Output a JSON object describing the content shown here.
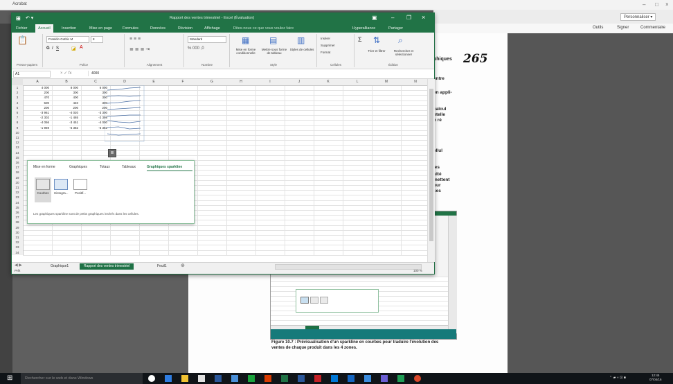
{
  "acrobat": {
    "menu": {
      "personalize": "Personnaliser ▾",
      "tools": "Outils",
      "sign": "Signer",
      "comment": "Commentaire"
    },
    "page_number": "265",
    "doc_heading_frag": "phiques",
    "doc_lines": [
      "entre",
      "en appli-",
      "calcul",
      "ntelle",
      "n ré",
      "ellul",
      "les",
      "ulté",
      "mettent",
      "our",
      "ces"
    ],
    "figure_caption": "Figure 10.7 : Prévisualisation d'un sparkline en courbes pour traduire l'évolution des ventes de chaque produit dans les 4 zones."
  },
  "excel": {
    "title": "Rapport des ventes trimestriel - Excel (Évaluation)",
    "account": "Hyperalliance",
    "share": "Partager",
    "tabs": [
      "Fichier",
      "Accueil",
      "Insertion",
      "Mise en page",
      "Formules",
      "Données",
      "Révision",
      "Affichage",
      "Dites-nous ce que vous voulez faire"
    ],
    "ribbon": {
      "font_name": "Franklin Gothic M",
      "font_size": "8",
      "number_format": "Standard",
      "groups": [
        "Presse-papiers",
        "Police",
        "Alignement",
        "Nombre",
        "Style",
        "Cellules",
        "Édition"
      ],
      "items": {
        "cond_format": "Mise en forme conditionnelle",
        "as_table": "Mettre sous forme de tableau",
        "cell_styles": "Styles de cellules",
        "insert": "Insérer",
        "delete": "Supprimer",
        "format": "Format",
        "sort_filter": "Trier et filtrer",
        "find_select": "Rechercher et sélectionner"
      }
    },
    "formula_bar": {
      "name_box": "A1",
      "formula": "4000"
    },
    "columns": [
      "A",
      "B",
      "C",
      "D",
      "E",
      "F",
      "G",
      "H",
      "I",
      "J",
      "K",
      "L",
      "M",
      "N"
    ],
    "rows": [
      [
        "4 000",
        "8 000",
        "6 000"
      ],
      [
        "200",
        "300",
        "300"
      ],
      [
        "470",
        "400",
        "300"
      ],
      [
        "500",
        "440",
        "300"
      ],
      [
        "200",
        "200",
        "200"
      ],
      [
        "-3 961",
        "-4 020",
        "-3 300"
      ],
      [
        "-2 302",
        "-1 465",
        "-2 398"
      ],
      [
        "-4 056",
        "-3 451",
        "-4 000"
      ],
      [
        "-1 969",
        "-6 382",
        "-6 382"
      ]
    ],
    "sheets": [
      "Graphique1",
      "Rapport des ventes trimestriel",
      "Feuil1"
    ],
    "status": {
      "ready": "Prêt",
      "zoom": "100 %"
    },
    "quick_analysis": {
      "tabs": [
        "Mise en forme",
        "Graphiques",
        "Totaux",
        "Tableaux",
        "Graphiques sparkline"
      ],
      "options": [
        "Courbes",
        "Histogra...",
        "Positif..."
      ],
      "description": "Les graphiques sparkline sont de petits graphiques insérés dans les cellules."
    }
  },
  "taskbar": {
    "search_placeholder": "Rechercher sur le web et dans Windows",
    "time": "12:45",
    "date": "07/04/16"
  },
  "colors": {
    "excel_green": "#217346",
    "taskbar": "#101418",
    "sheet_active": "#1e7145"
  }
}
